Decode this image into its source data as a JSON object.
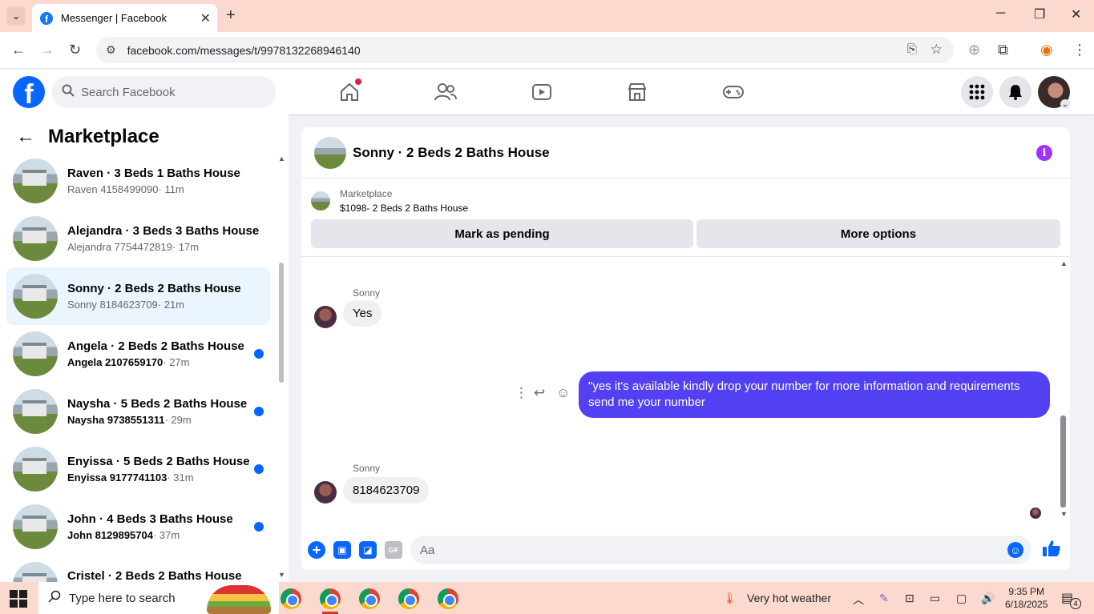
{
  "browser": {
    "tab_title": "Messenger | Facebook",
    "url": "facebook.com/messages/t/9978132268946140"
  },
  "facebook": {
    "search_placeholder": "Search Facebook"
  },
  "sidebar": {
    "title": "Marketplace",
    "conversations": [
      {
        "title": "Raven · 3 Beds 1 Baths House",
        "subtitle_name": "Raven 4158499090",
        "time": "· 11m",
        "unread": false,
        "active": false
      },
      {
        "title": "Alejandra · 3 Beds 3 Baths House",
        "subtitle_name": "Alejandra 7754472819",
        "time": "· 17m",
        "unread": false,
        "active": false
      },
      {
        "title": "Sonny · 2 Beds 2 Baths House",
        "subtitle_name": "Sonny 8184623709",
        "time": "· 21m",
        "unread": false,
        "active": true
      },
      {
        "title": "Angela · 2 Beds 2 Baths House",
        "subtitle_name": "Angela 2107659170",
        "time": "· 27m",
        "unread": true,
        "active": false
      },
      {
        "title": "Naysha · 5 Beds 2 Baths House",
        "subtitle_name": "Naysha 9738551311",
        "time": "· 29m",
        "unread": true,
        "active": false
      },
      {
        "title": "Enyissa · 5 Beds 2 Baths House",
        "subtitle_name": "Enyissa 9177741103",
        "time": "· 31m",
        "unread": true,
        "active": false
      },
      {
        "title": "John · 4 Beds 3 Baths House",
        "subtitle_name": "John 8129895704",
        "time": "· 37m",
        "unread": true,
        "active": false
      },
      {
        "title": "Cristel · 2 Beds 2 Baths House",
        "subtitle_name": "",
        "time": "",
        "unread": false,
        "active": false
      }
    ]
  },
  "chat": {
    "title": "Sonny · 2 Beds 2 Baths House",
    "marketplace_label": "Marketplace",
    "listing": "$1098- 2 Beds 2 Baths House",
    "mark_pending_label": "Mark as pending",
    "more_options_label": "More options",
    "messages": [
      {
        "sender": "Sonny",
        "text": "Yes"
      },
      {
        "sender": "me",
        "text": "\"yes it's available kindly drop your number for more information and requirements send me your number"
      },
      {
        "sender": "Sonny",
        "text": "8184623709"
      }
    ],
    "composer_placeholder": "Aa",
    "gif_label": "GIF"
  },
  "taskbar": {
    "search_placeholder": "Type here to search",
    "weather": "Very hot weather",
    "time": "9:35 PM",
    "date": "6/18/2025",
    "notification_count": "4"
  }
}
